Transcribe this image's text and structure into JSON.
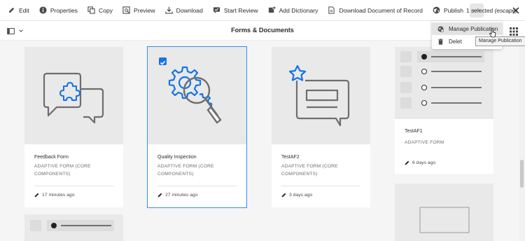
{
  "toolbar": {
    "items": [
      {
        "label": "Edit",
        "icon": "pencil-icon"
      },
      {
        "label": "Properties",
        "icon": "info-icon"
      },
      {
        "label": "Copy",
        "icon": "copy-icon"
      },
      {
        "label": "Preview",
        "icon": "preview-icon"
      },
      {
        "label": "Download",
        "icon": "download-icon"
      },
      {
        "label": "Start Review",
        "icon": "review-icon"
      },
      {
        "label": "Add Dictionary",
        "icon": "dictionary-icon"
      },
      {
        "label": "Download Document of Record",
        "icon": "document-icon"
      },
      {
        "label": "Publish",
        "icon": "globe-icon"
      }
    ],
    "more_label": "...",
    "selection_status": "1 selected",
    "selection_hint": "(escape)"
  },
  "subbar": {
    "title": "Forms & Documents"
  },
  "menu": {
    "items": [
      {
        "label": "Manage Publication",
        "icon": "publication-icon"
      },
      {
        "label": "Delet",
        "icon": "trash-icon"
      }
    ],
    "tooltip": "Manage Publication"
  },
  "cards": [
    {
      "title": "Feedback Form",
      "type_line1": "ADAPTIVE FORM (CORE",
      "type_line2": "COMPONENTS)",
      "modified": "17 minutes ago",
      "selected": false,
      "thumbnail": "chat-puzzle-icon"
    },
    {
      "title": "Quality Inspection",
      "type_line1": "ADAPTIVE FORM (CORE",
      "type_line2": "COMPONENTS)",
      "modified": "27 minutes ago",
      "selected": true,
      "thumbnail": "gear-magnifier-icon"
    },
    {
      "title": "TestAF2",
      "type_line1": "ADAPTIVE FORM (CORE",
      "type_line2": "COMPONENTS)",
      "modified": "3 days ago",
      "selected": false,
      "thumbnail": "star-message-icon"
    },
    {
      "title": "TestAF1",
      "type_line1": "ADAPTIVE FORM",
      "type_line2": "",
      "modified": "6 days ago",
      "selected": false,
      "thumbnail": "form-preview"
    }
  ],
  "colors": {
    "accent": "#1473e6",
    "selected_outline": "#378ef0",
    "icon_stroke": "#6e6e6e"
  }
}
